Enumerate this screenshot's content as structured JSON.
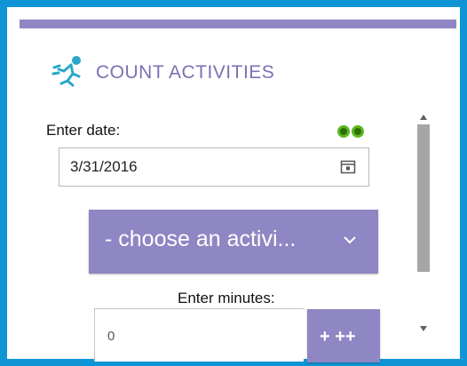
{
  "header": {
    "title": "COUNT ACTIVITIES",
    "icon": "running-person-icon"
  },
  "date_field": {
    "label": "Enter date:",
    "value": "3/31/2016",
    "icon": "calendar-icon",
    "status_icon": "binoculars-icon"
  },
  "activity_select": {
    "value": "- choose an activi...",
    "icon": "chevron-down-icon"
  },
  "minutes_field": {
    "label": "Enter minutes:",
    "value": "0"
  },
  "add_button": {
    "label": "+ ++"
  },
  "colors": {
    "accent": "#8f87c3",
    "frame": "#0f95d6",
    "title": "#7f6fb3",
    "status": "#5db71f"
  }
}
